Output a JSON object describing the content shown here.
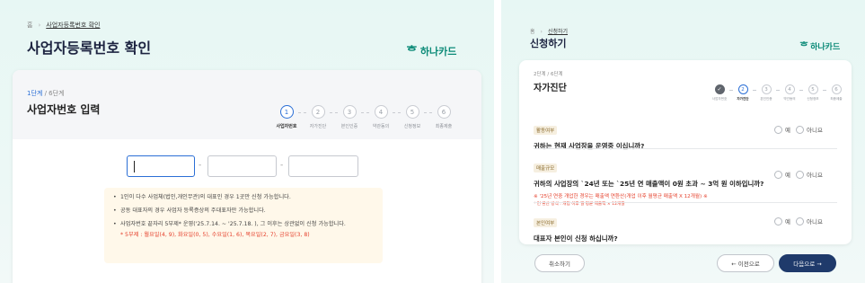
{
  "left": {
    "breadcrumb": {
      "home": "홈",
      "current": "사업자등록번호 확인"
    },
    "title": "사업자등록번호 확인",
    "logo": "하나카드",
    "step_label": {
      "current": "1단계",
      "total": " / 6단계"
    },
    "card_title": "사업자번호 입력",
    "steps": [
      {
        "num": "1",
        "label": "사업자번호"
      },
      {
        "num": "2",
        "label": "자가진단"
      },
      {
        "num": "3",
        "label": "본인인증"
      },
      {
        "num": "4",
        "label": "약관동의"
      },
      {
        "num": "5",
        "label": "신청정보"
      },
      {
        "num": "6",
        "label": "최종제출"
      }
    ],
    "separator": "-",
    "notices": [
      "1인이 다수 사업체(법인,개인무관)의 대표인 경우 1곳만 신청 가능합니다.",
      "공동 대표자의 경우 사업자 등록증상의 주대표자만 가능합니다.",
      "사업자번호 끝자리 5부제* 운영('25.7.14. ~ '25.7.18. ), 그 이후는 상관없이 신청 가능합니다."
    ],
    "notice_red": "* 5부제 : 월요일(4, 9), 화요일(0, 5), 수요일(1, 6), 목요일(2, 7), 금요일(3, 8)"
  },
  "right": {
    "breadcrumb": {
      "home": "홈",
      "current": "신청하기"
    },
    "title": "신청하기",
    "logo": "하나카드",
    "step_label": "2단계 / 6단계",
    "card_title": "자가진단",
    "steps": [
      {
        "num": "✓",
        "label": "사업자번호"
      },
      {
        "num": "2",
        "label": "자가진단"
      },
      {
        "num": "3",
        "label": "본인인증"
      },
      {
        "num": "4",
        "label": "약관동의"
      },
      {
        "num": "5",
        "label": "신청정보"
      },
      {
        "num": "6",
        "label": "최종제출"
      }
    ],
    "questions": [
      {
        "tag": "활동여부",
        "text": "귀하는 현재 사업장을 운영중 이십니까?"
      },
      {
        "tag": "매출규모",
        "text": "귀하의 사업장의 `24년 또는 `25년 연 매출액이 0원 초과 ~ 3억 원 이하입니까?",
        "note": "※ '25년 연중 개업한 경우는 매출액 연환산(개업 이후 월평균 매출액 X 12개월) ※",
        "note2": "* 연 환산 방식 : 개업 이후 월 평균 매출액 × 12개월"
      },
      {
        "tag": "본인여부",
        "text": "대표자 본인이 신청 하십니까?"
      }
    ],
    "yes": "예",
    "no": "아니요",
    "buttons": {
      "cancel": "취소하기",
      "prev": "← 이전으로",
      "next": "다음으로 →"
    }
  }
}
